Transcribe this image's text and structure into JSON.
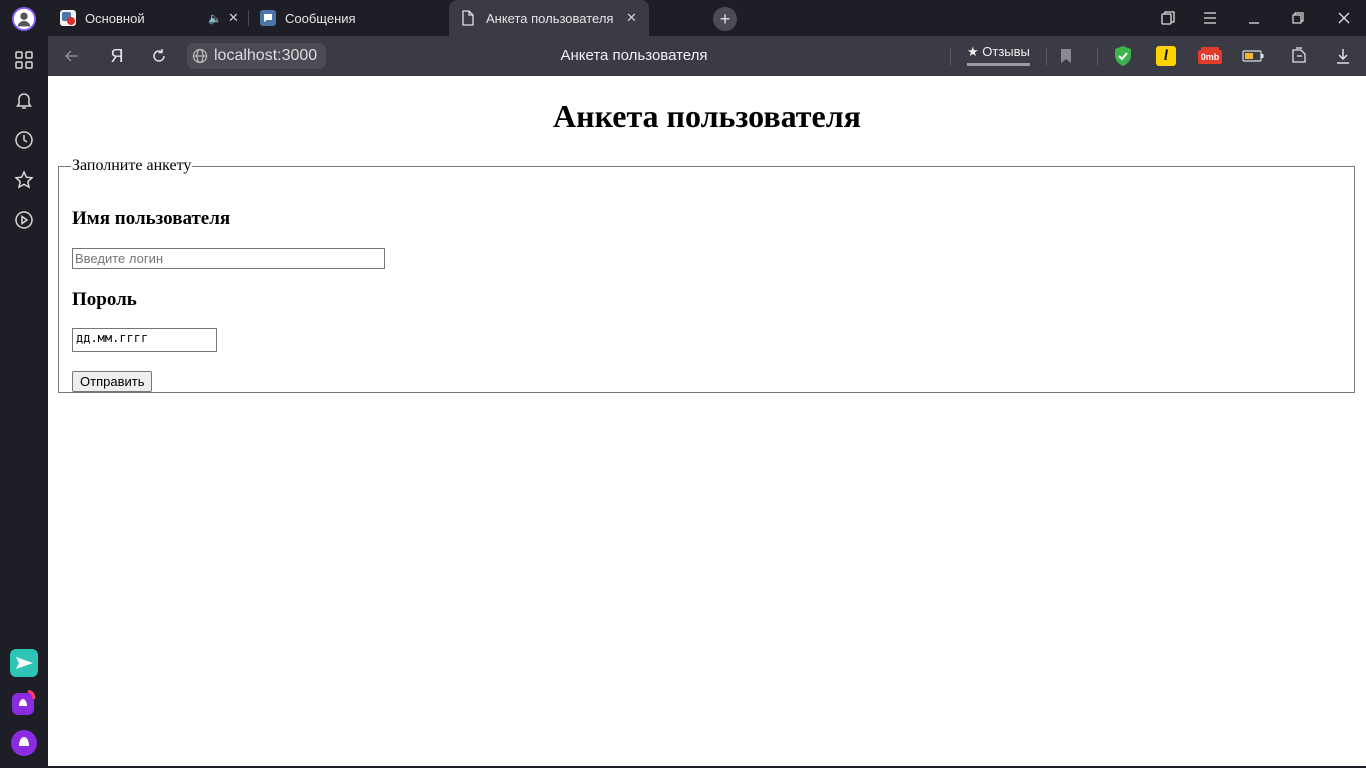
{
  "tabs": [
    {
      "label": "Основной",
      "favicon_color": "#c92a3c",
      "audio": true
    },
    {
      "label": "Сообщения",
      "favicon_color": "#4a76a8"
    },
    {
      "label": "Анкета пользователя",
      "active": true
    }
  ],
  "window": {
    "close_glyph": "✕",
    "new_tab_glyph": "+"
  },
  "address_bar": {
    "url": "localhost:3000",
    "page_title": "Анкета пользователя",
    "reviews_label": "★ Отзывы",
    "yandex_glyph": "Я"
  },
  "extensions": {
    "omb_label": "0mb",
    "l_label": "l"
  },
  "page": {
    "heading": "Анкета пользователя",
    "fieldset_legend": "Заполните анкету",
    "username_label": "Имя пользователя",
    "username_placeholder": "Введите логин",
    "password_label": "Пороль",
    "date_value": "дд.мм.гггг",
    "submit_label": "Отправить"
  },
  "colors": {
    "accent_shield": "#3cb44b",
    "chrome_dark": "#1e1f26",
    "chrome_mid": "#3a3b45"
  }
}
